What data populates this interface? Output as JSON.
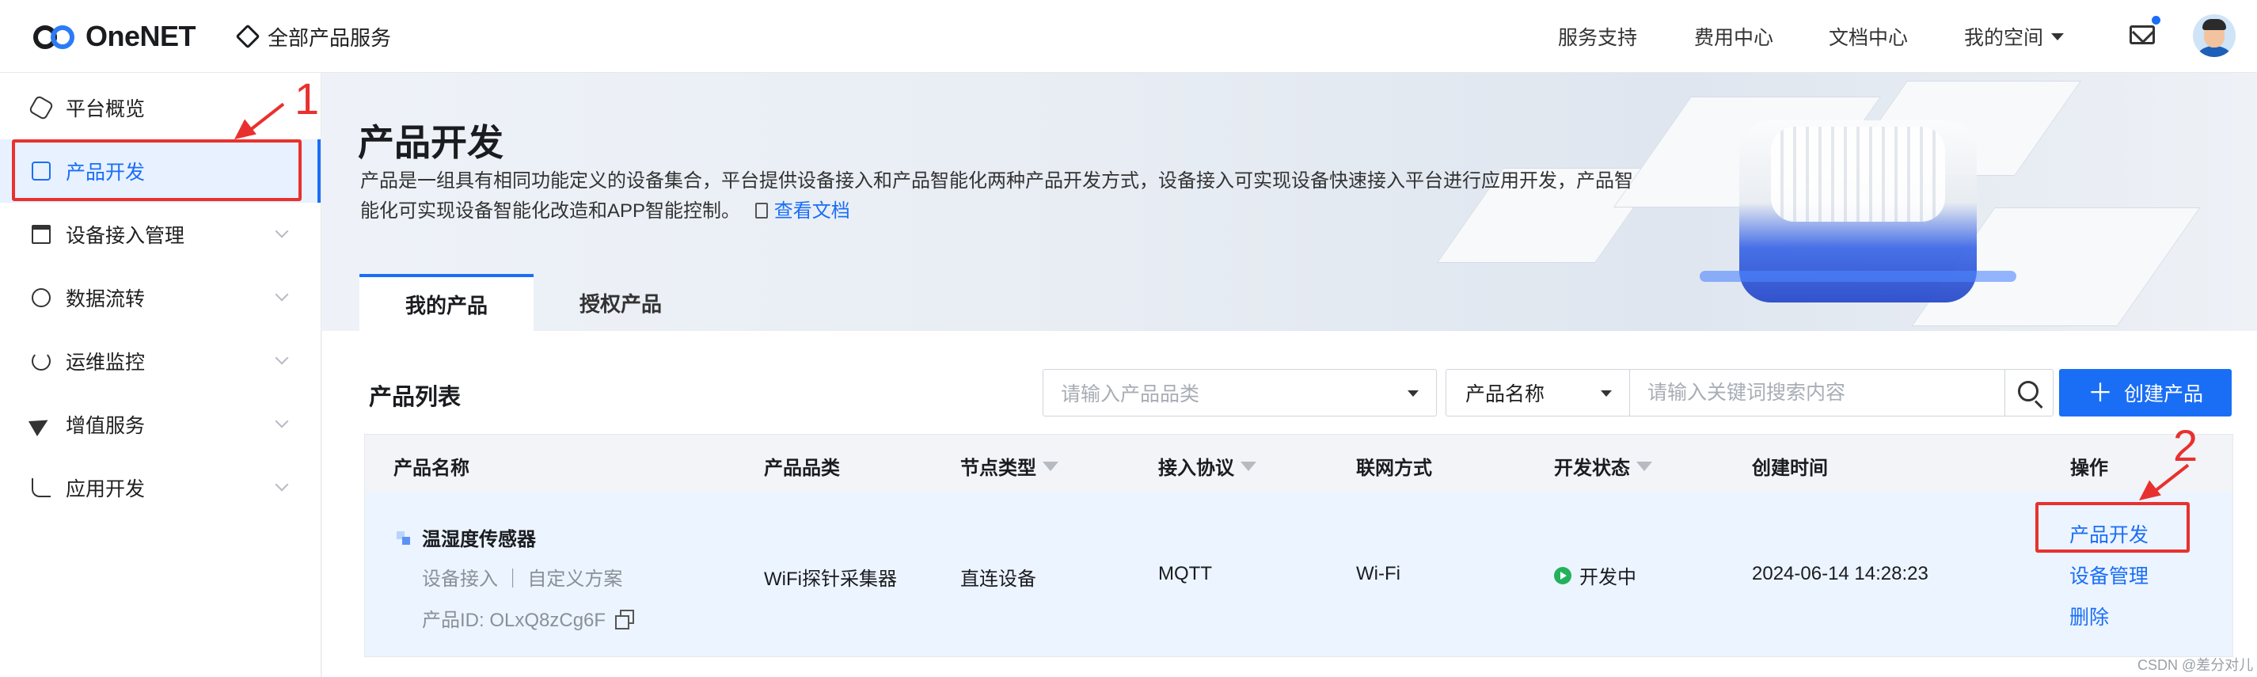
{
  "topbar": {
    "logo_text": "OneNET",
    "all_products": "全部产品服务",
    "nav": [
      "服务支持",
      "费用中心",
      "文档中心",
      "我的空间"
    ]
  },
  "sidebar": {
    "items": [
      {
        "label": "平台概览",
        "icon": "hexagon-icon",
        "expandable": false,
        "active": false
      },
      {
        "label": "产品开发",
        "icon": "cube-icon",
        "expandable": false,
        "active": true
      },
      {
        "label": "设备接入管理",
        "icon": "device-access-icon",
        "expandable": true,
        "active": false
      },
      {
        "label": "数据流转",
        "icon": "data-flow-icon",
        "expandable": true,
        "active": false
      },
      {
        "label": "运维监控",
        "icon": "pie-chart-icon",
        "expandable": true,
        "active": false
      },
      {
        "label": "增值服务",
        "icon": "paper-plane-icon",
        "expandable": true,
        "active": false
      },
      {
        "label": "应用开发",
        "icon": "app-dev-icon",
        "expandable": true,
        "active": false
      }
    ]
  },
  "banner": {
    "title": "产品开发",
    "description_line1": "产品是一组具有相同功能定义的设备集合，平台提供设备接入和产品智能化两种产品开发方式，设备接入可实现设备快速接入平台进行应用开发，产品智",
    "description_line2": "能化可实现设备智能化改造和APP智能控制。",
    "doc_link": "查看文档"
  },
  "tabs": [
    "我的产品",
    "授权产品"
  ],
  "list": {
    "title": "产品列表",
    "category_placeholder": "请输入产品品类",
    "name_select": "产品名称",
    "keyword_placeholder": "请输入关键词搜索内容",
    "create_button": "创建产品"
  },
  "table": {
    "headers": [
      "产品名称",
      "产品品类",
      "节点类型",
      "接入协议",
      "联网方式",
      "开发状态",
      "创建时间",
      "操作"
    ],
    "rows": [
      {
        "name": "温湿度传感器",
        "sub": "设备接入 ｜ 自定义方案",
        "product_id": "产品ID:  OLxQ8zCg6F",
        "category": "WiFi探针采集器",
        "node_type": "直连设备",
        "protocol": "MQTT",
        "network": "Wi-Fi",
        "status": "开发中",
        "created": "2024-06-14 14:28:23",
        "actions": [
          "产品开发",
          "设备管理",
          "删除"
        ]
      }
    ]
  },
  "annotations": {
    "label_1": "1",
    "label_2": "2",
    "color": "#e8312f"
  },
  "watermark": "CSDN @差分对儿",
  "colors": {
    "primary": "#1a6ef6",
    "status_green": "#23b15d"
  }
}
